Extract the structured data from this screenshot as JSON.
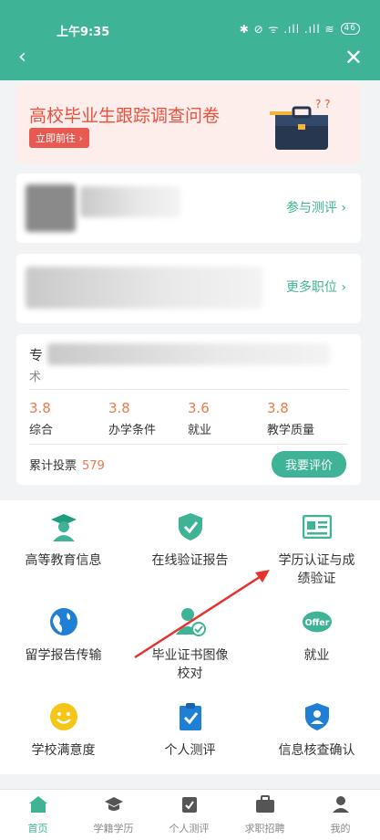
{
  "status": {
    "time": "上午9:35",
    "icons": "✱ ⊘ ᯤ .ıll .ıll ≋",
    "battery": "46"
  },
  "banner": {
    "title": "高校毕业生跟踪调查问卷",
    "button": "立即前往 ›"
  },
  "card2": {
    "link": "参与测评 ›"
  },
  "card3": {
    "link": "更多职位 ›"
  },
  "card4": {
    "prefix": "专",
    "prefix2": "术",
    "scores": [
      {
        "value": "3.8",
        "label": "综合"
      },
      {
        "value": "3.8",
        "label": "办学条件"
      },
      {
        "value": "3.6",
        "label": "就业"
      },
      {
        "value": "3.8",
        "label": "教学质量"
      }
    ],
    "vote_label": "累计投票",
    "vote_count": "579",
    "rate_button": "我要评价"
  },
  "grid": [
    {
      "label": "高等教育信息",
      "icon": "graduate-icon"
    },
    {
      "label": "在线验证报告",
      "icon": "shield-check-icon"
    },
    {
      "label": "学历认证与成\n绩验证",
      "icon": "id-card-icon"
    },
    {
      "label": "留学报告传输",
      "icon": "globe-icon"
    },
    {
      "label": "毕业证书图像\n校对",
      "icon": "user-check-icon"
    },
    {
      "label": "就业",
      "icon": "offer-icon"
    },
    {
      "label": "学校满意度",
      "icon": "smiley-icon"
    },
    {
      "label": "个人测评",
      "icon": "clipboard-check-icon"
    },
    {
      "label": "信息核查确认",
      "icon": "user-shield-icon"
    }
  ],
  "tabs": [
    {
      "label": "首页",
      "icon": "home-icon",
      "active": true
    },
    {
      "label": "学籍学历",
      "icon": "cap-icon"
    },
    {
      "label": "个人测评",
      "icon": "clipboard-icon"
    },
    {
      "label": "求职招聘",
      "icon": "briefcase-icon"
    },
    {
      "label": "我的",
      "icon": "user-icon"
    }
  ],
  "colors": {
    "primary": "#3eb395",
    "accent": "#e8503c",
    "score": "#e87a4c"
  }
}
